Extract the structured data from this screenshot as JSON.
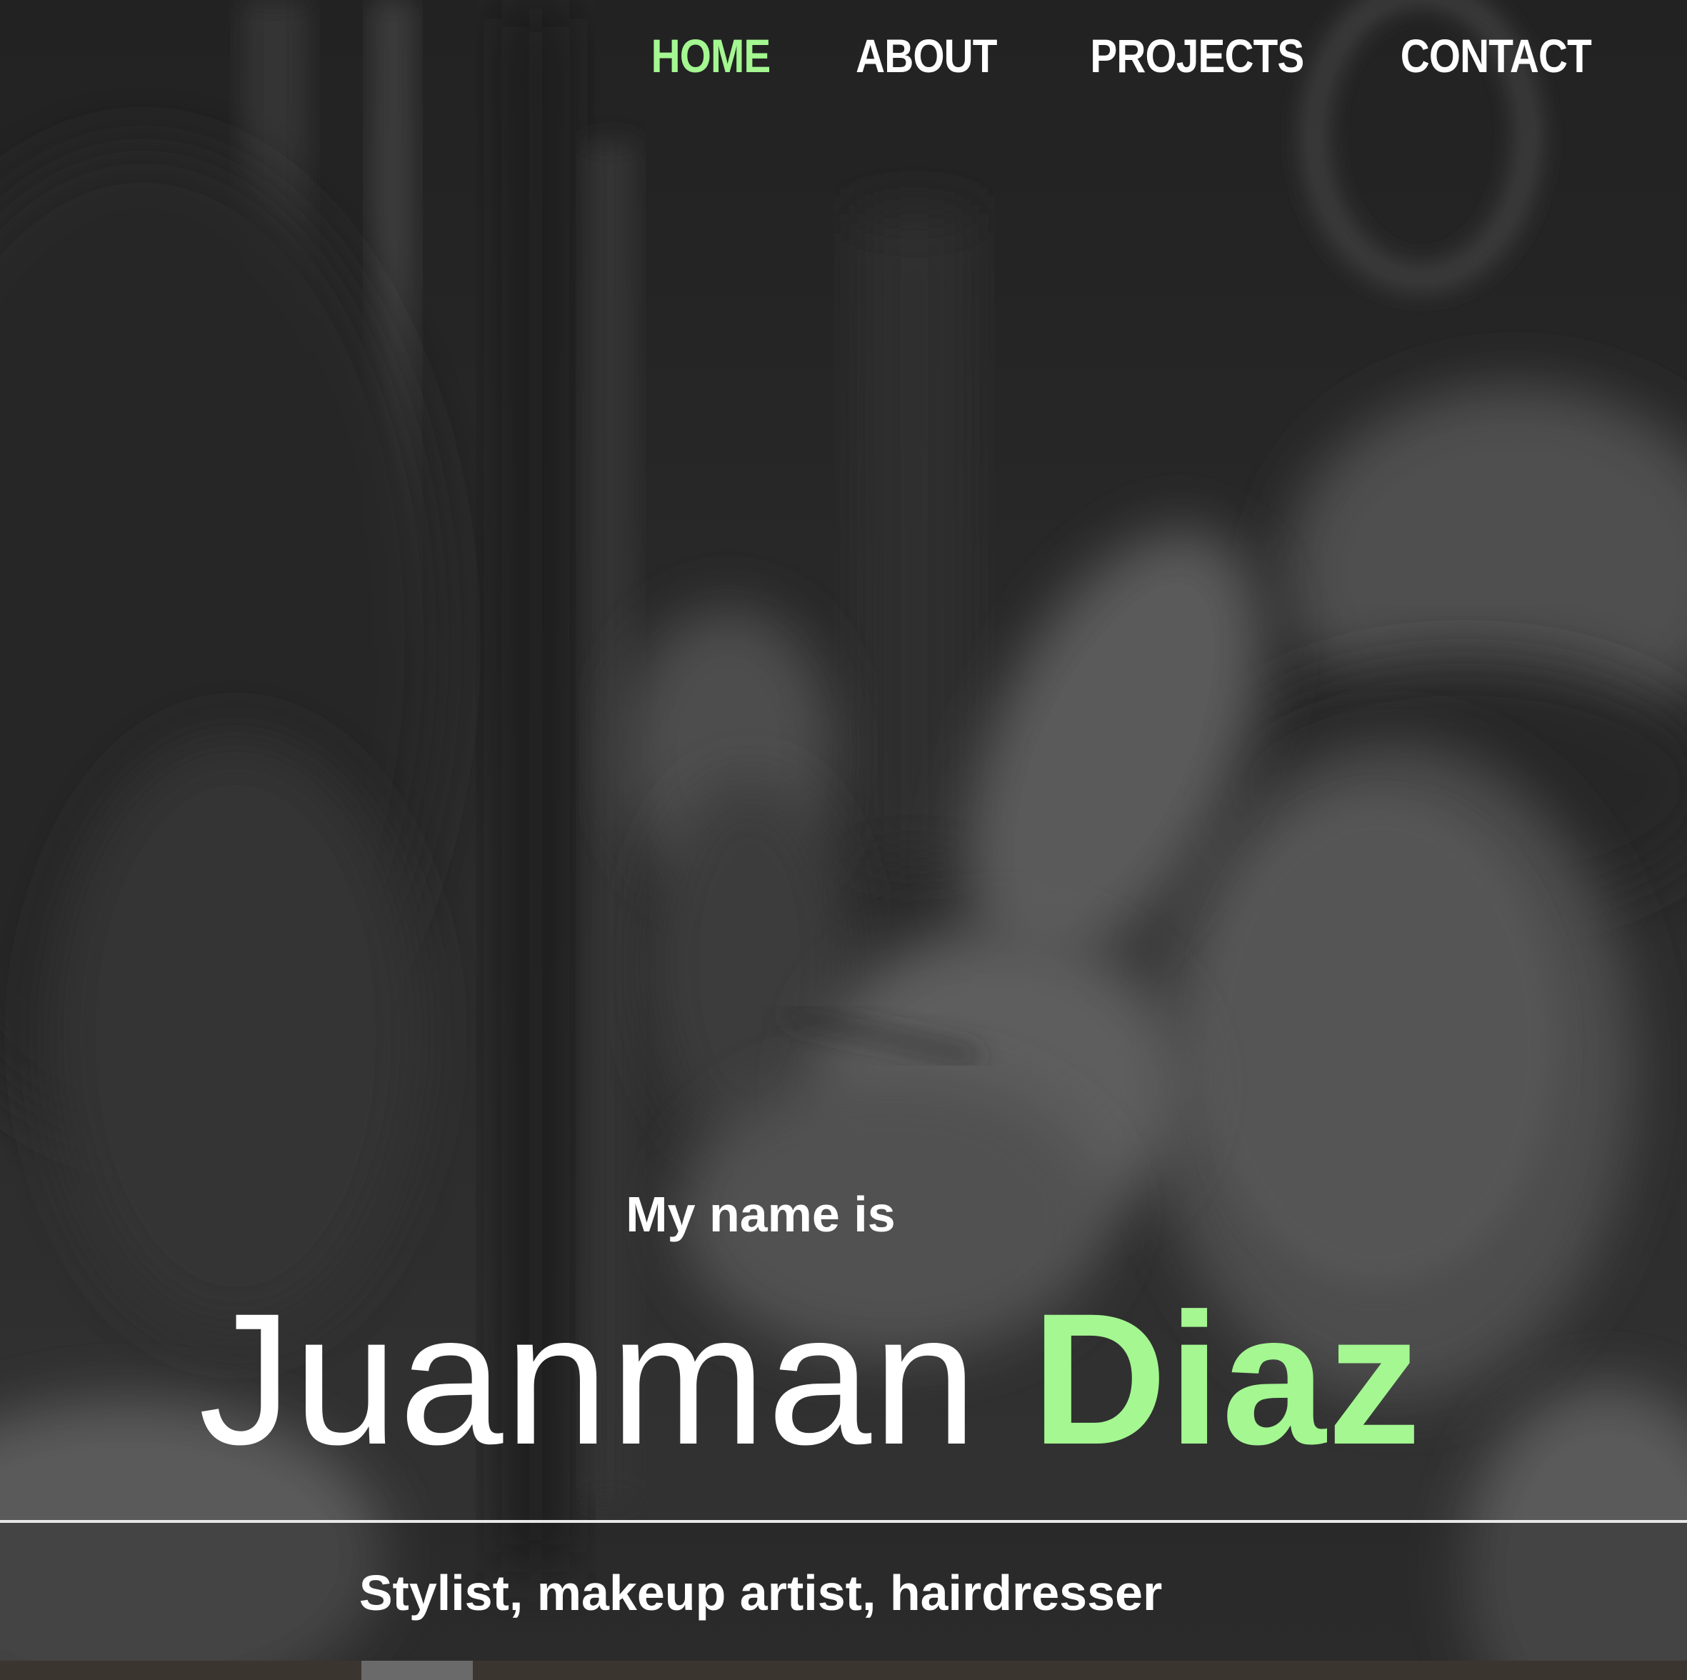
{
  "nav": {
    "items": [
      {
        "label": "HOME",
        "active": true
      },
      {
        "label": "ABOUT",
        "active": false
      },
      {
        "label": "PROJECTS",
        "active": false
      },
      {
        "label": "CONTACT",
        "active": false
      }
    ]
  },
  "hero": {
    "intro": "My name is",
    "first_name": "Juanman",
    "last_name": "Diaz",
    "tagline": "Stylist, makeup artist, hairdresser"
  },
  "colors": {
    "accent": "#a4f791",
    "text": "#ffffff",
    "background": "#2a2a2a"
  }
}
